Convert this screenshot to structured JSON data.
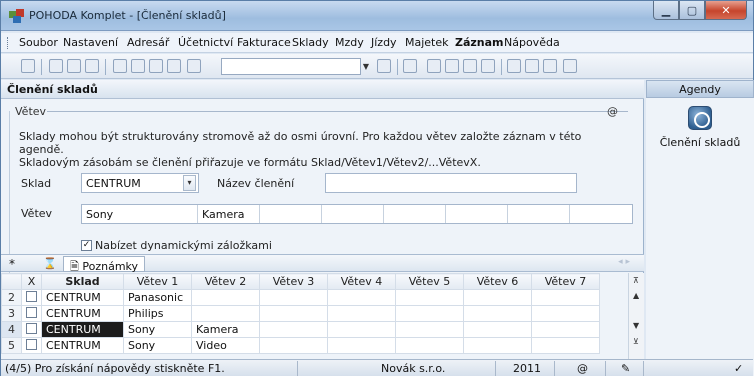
{
  "window": {
    "title": "POHODA Komplet - [Členění skladů]"
  },
  "menu": [
    {
      "label": "Soubor",
      "bold": false
    },
    {
      "label": "Nastavení",
      "bold": false
    },
    {
      "label": "Adresář",
      "bold": false
    },
    {
      "label": "Účetnictví",
      "bold": false
    },
    {
      "label": "Fakturace",
      "bold": false
    },
    {
      "label": "Sklady",
      "bold": false
    },
    {
      "label": "Mzdy",
      "bold": false
    },
    {
      "label": "Jízdy",
      "bold": false
    },
    {
      "label": "Majetek",
      "bold": false
    },
    {
      "label": "Záznam",
      "bold": true
    },
    {
      "label": "Nápověda",
      "bold": false
    }
  ],
  "document": {
    "header": "Členění skladů",
    "group_title": "Větev",
    "group_at": "@",
    "description_line1": "Sklady mohou být strukturovány stromově až do osmi úrovní. Pro každou větev založte záznam v této agendě.",
    "description_line2": "Skladovým zásobám se členění přiřazuje ve formátu Sklad/Větev1/Větev2/...VětevX.",
    "sklad_label": "Sklad",
    "sklad_value": "CENTRUM",
    "nazev_label": "Název členění",
    "nazev_value": "",
    "vetev_label": "Větev",
    "vetev_values": [
      "Sony",
      "Kamera",
      "",
      "",
      "",
      "",
      "",
      ""
    ],
    "checkbox_label": "Nabízet dynamickými záložkami",
    "checkbox_checked": true
  },
  "grid": {
    "star": "*",
    "tab_label": "Poznámky",
    "columns": [
      "X",
      "Sklad",
      "Větev 1",
      "Větev 2",
      "Větev 3",
      "Větev 4",
      "Větev 5",
      "Větev 6",
      "Větev 7"
    ],
    "rows": [
      {
        "num": "2",
        "sklad": "CENTRUM",
        "v1": "Panasonic",
        "v2": ""
      },
      {
        "num": "3",
        "sklad": "CENTRUM",
        "v1": "Philips",
        "v2": ""
      },
      {
        "num": "4",
        "sklad": "CENTRUM",
        "v1": "Sony",
        "v2": "Kamera",
        "current": true
      },
      {
        "num": "5",
        "sklad": "CENTRUM",
        "v1": "Sony",
        "v2": "Video"
      }
    ]
  },
  "agendy": {
    "header": "Agendy",
    "item": "Členění skladů"
  },
  "status": {
    "hint": "(4/5) Pro získání nápovědy stiskněte F1.",
    "company": "Novák s.r.o.",
    "year": "2011",
    "at": "@"
  }
}
